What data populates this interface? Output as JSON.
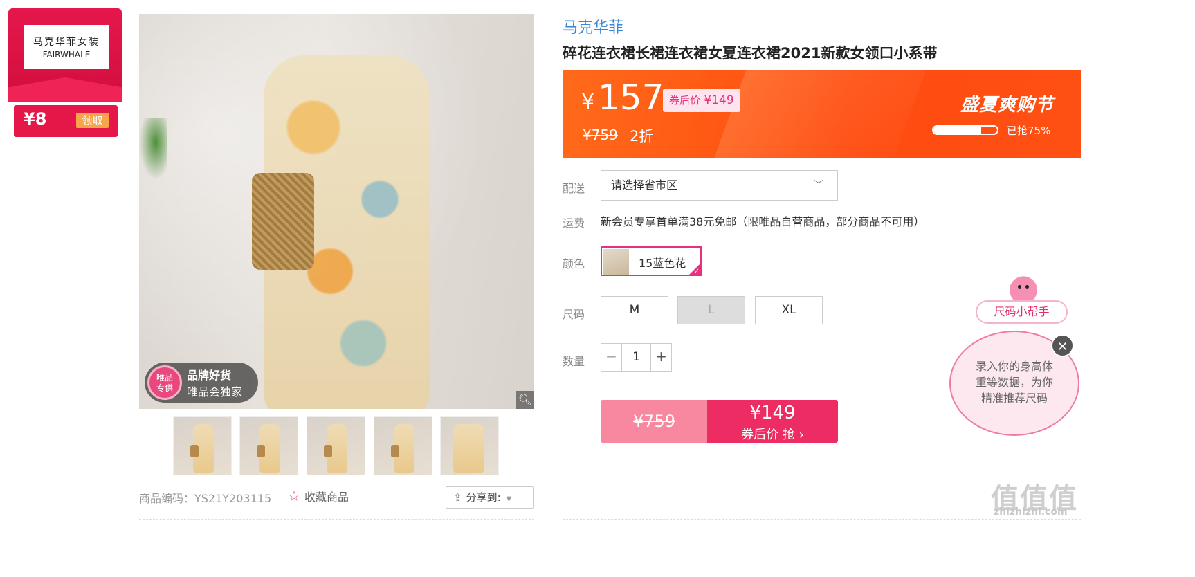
{
  "brand_coupon": {
    "logo_cn": "马克华菲女装",
    "logo_en": "FAIRWHALE",
    "amount": "¥8",
    "claim_label": "领取"
  },
  "gallery": {
    "badge_circle": "唯品\n专供",
    "badge_title": "品牌好货",
    "badge_sub": "唯品会独家",
    "thumb_count": 5
  },
  "footer": {
    "sku_code": "商品编码：YS21Y203115",
    "fav_label": "收藏商品",
    "share_label": "分享到:"
  },
  "product": {
    "brand": "马克华菲",
    "title": "碎花连衣裙长裙连衣裙女夏连衣裙2021新款女领口小系带"
  },
  "price": {
    "currency": "¥",
    "current": "157",
    "coupon_prefix": "券后价",
    "coupon_price": "¥149",
    "original": "¥759",
    "discount": "2折",
    "promo_title": "盛夏爽购节",
    "progress_fraction": 0.75,
    "progress_text": "已抢75%"
  },
  "options": {
    "delivery_label": "配送",
    "delivery_placeholder": "请选择省市区",
    "shipping_label": "运费",
    "shipping_text": "新会员专享首单满38元免邮（限唯品自营商品，部分商品不可用）",
    "color_label": "颜色",
    "color_value": "15蓝色花",
    "size_label": "尺码",
    "sizes": [
      "M",
      "L",
      "XL"
    ],
    "qty_label": "数量",
    "qty_minus": "−",
    "qty_value": "1",
    "qty_plus": "+"
  },
  "buy": {
    "original": "¥759",
    "price": "¥149",
    "cta": "券后价 抢 ›"
  },
  "helper": {
    "button": "尺码小帮手",
    "bubble": "录入你的身高体重等数据，为你精准推荐尺码",
    "close": "✕"
  },
  "watermark": {
    "main": "值值值",
    "sub": "zhizhizhi.com"
  },
  "colors": {
    "accent_pink": "#e6317f",
    "banner_orange": "#ff4b10",
    "brand_blue": "#3a86d9"
  }
}
